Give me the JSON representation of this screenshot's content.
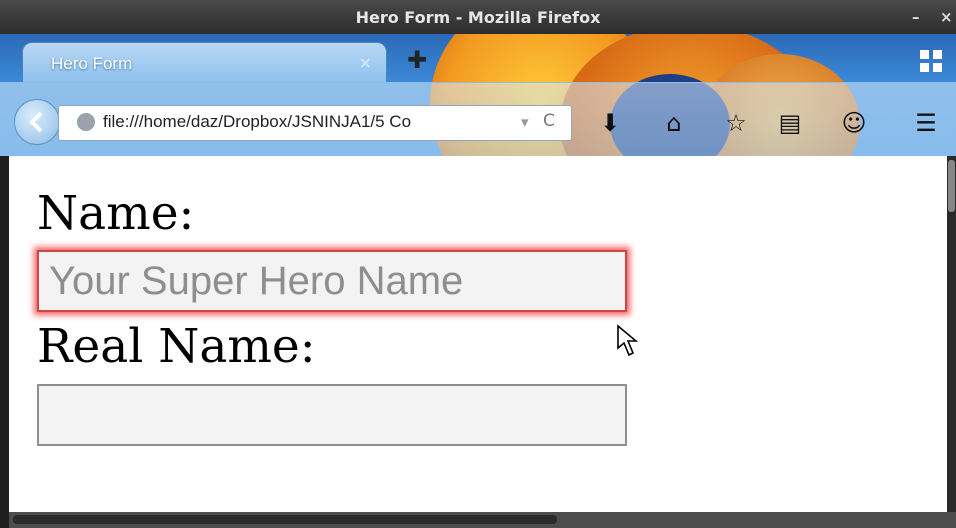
{
  "window": {
    "title": "Hero Form - Mozilla Firefox",
    "minimize": "–",
    "close": "×"
  },
  "tab": {
    "label": "Hero Form",
    "close": "×",
    "new_tab": "✚"
  },
  "toolbar": {
    "url": "file:///home/daz/Dropbox/JSNINJA1/5 Co",
    "url_dropdown": "▾",
    "reload": "C",
    "icons": [
      "download-icon",
      "home-icon",
      "bookmark-star-icon",
      "reading-list-icon",
      "ghostery-icon",
      "menu-icon"
    ]
  },
  "form": {
    "name_label": "Name:",
    "name_placeholder": "Your Super Hero Name",
    "name_value": "",
    "realname_label": "Real Name:",
    "realname_value": ""
  },
  "colors": {
    "focus_glow": "#f04646",
    "toolbar_blue": "#3c8ad8",
    "fox_orange": "#f39a21"
  }
}
